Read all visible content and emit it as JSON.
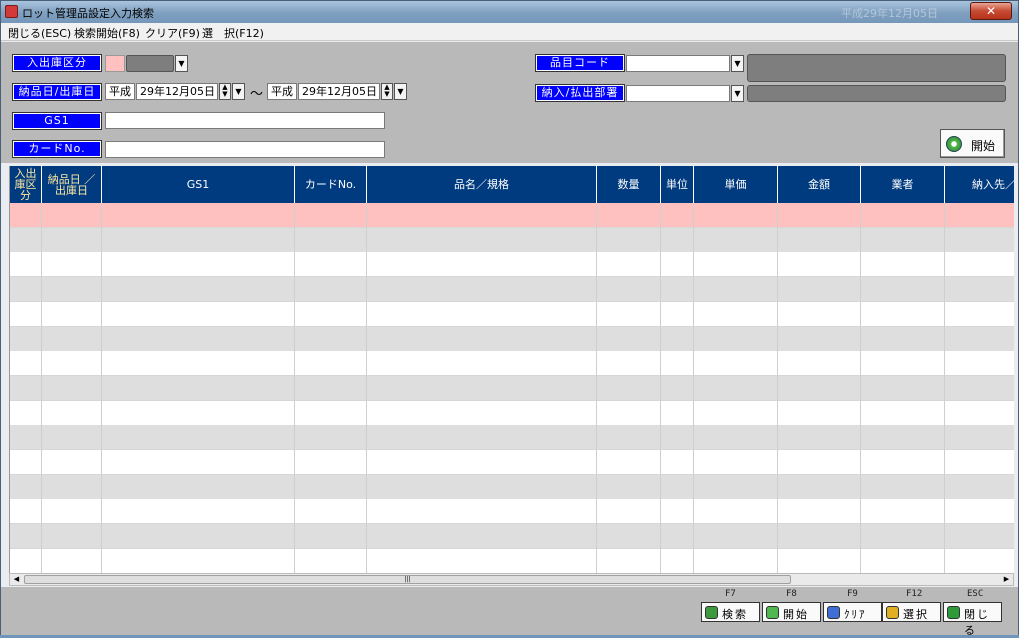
{
  "window": {
    "title": "ロット管理品設定入力検索",
    "ghost_text": "平成29年12月05日",
    "close_label": "✕"
  },
  "menu": [
    {
      "label": "閉じる(ESC)"
    },
    {
      "label": "検索開始(F8)"
    },
    {
      "label": "クリア(F9)"
    },
    {
      "label": "選　択(F12)"
    }
  ],
  "search": {
    "inout_label": "入出庫区分",
    "date_label": "納品日/出庫日",
    "era_from": "平成",
    "date_from": "29年12月05日",
    "range_sep": "〜",
    "era_to": "平成",
    "date_to": "29年12月05日",
    "gs1_label": "GS1",
    "gs1_value": "",
    "card_label": "カードNo.",
    "card_value": "",
    "item_code_label": "品目コード",
    "item_code_value": "",
    "dept_label": "納入/払出部署",
    "dept_value": "",
    "start_button": "開始"
  },
  "grid": {
    "columns": [
      {
        "label": "入出\n庫区\n分",
        "color": "yellow"
      },
      {
        "label": "納品日 ／\n出庫日",
        "color": "yellow"
      },
      {
        "label": "GS1",
        "color": "white"
      },
      {
        "label": "カードNo.",
        "color": "white"
      },
      {
        "label": "品名／規格",
        "color": "white"
      },
      {
        "label": "数量",
        "color": "white"
      },
      {
        "label": "単位",
        "color": "white"
      },
      {
        "label": "単価",
        "color": "white"
      },
      {
        "label": "金額",
        "color": "white"
      },
      {
        "label": "業者",
        "color": "white"
      },
      {
        "label": "納入先／払",
        "color": "white"
      }
    ],
    "row_count": 15,
    "selected_row": 0,
    "colors": {
      "header": "#003b80",
      "selected": "#ffc0c0",
      "even": "#dedede",
      "odd": "#ffffff"
    }
  },
  "footer": {
    "buttons": [
      {
        "key": "F7",
        "label": "検索",
        "icon": "magnifier-icon",
        "color": "#3c9a3c"
      },
      {
        "key": "F8",
        "label": "開始",
        "icon": "start-icon",
        "color": "#4fb84f"
      },
      {
        "key": "F9",
        "label": "ｸﾘｱ",
        "icon": "check-icon",
        "color": "#3f6fd6"
      },
      {
        "key": "F12",
        "label": "選択",
        "icon": "select-icon",
        "color": "#e0b020"
      },
      {
        "key": "ESC",
        "label": "閉じる",
        "icon": "exit-icon",
        "color": "#2e9a3a"
      }
    ]
  }
}
